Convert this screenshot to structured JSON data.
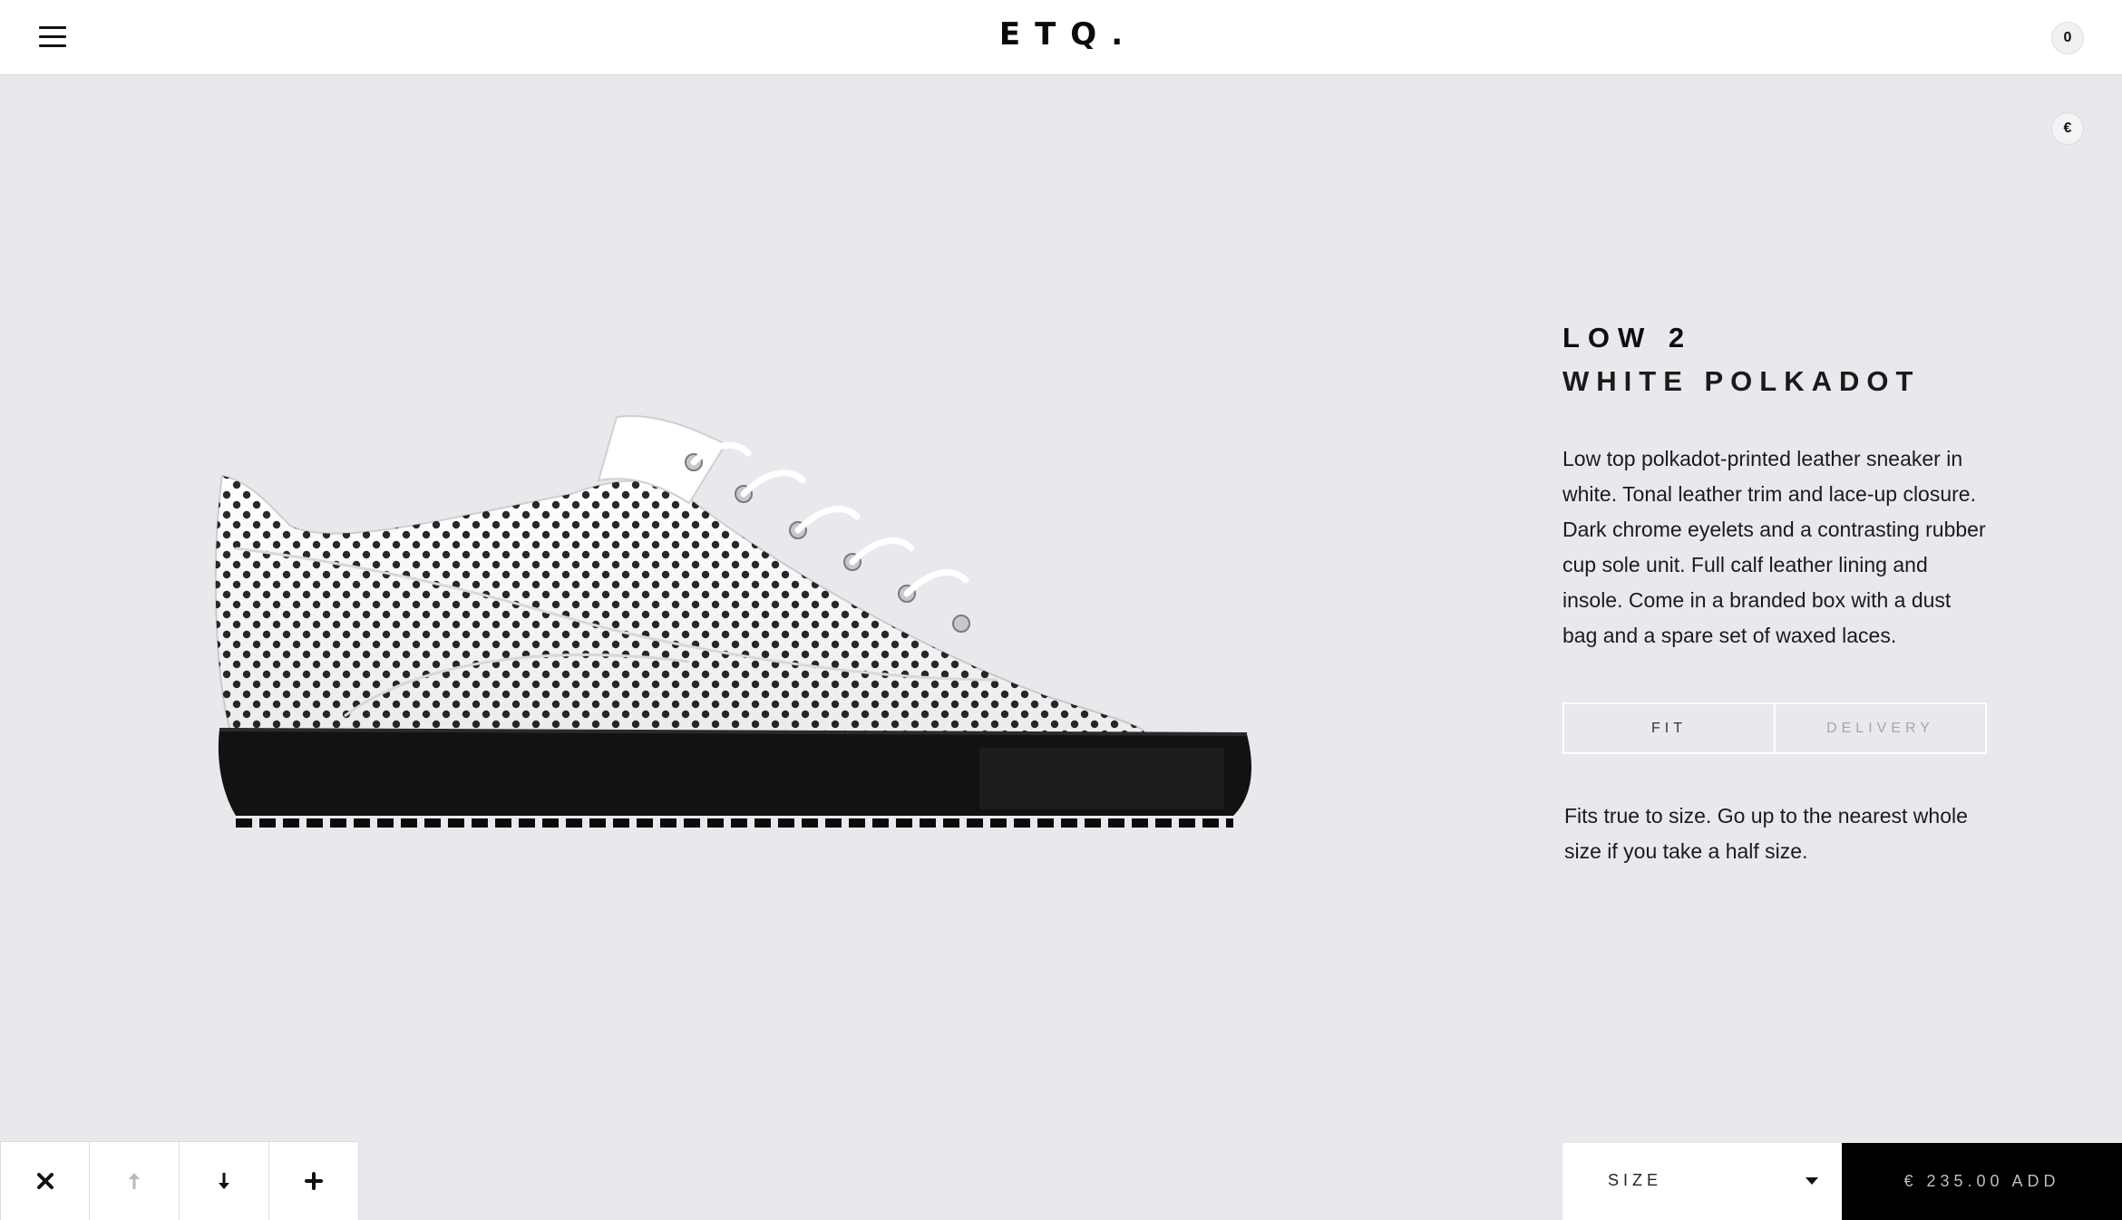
{
  "header": {
    "brand": "ETQ.",
    "cart_count": "0"
  },
  "currency": {
    "symbol": "€"
  },
  "product": {
    "name": "LOW 2",
    "variant": "WHITE POLKADOT",
    "description": "Low top polkadot-printed leather sneaker in white. Tonal leather trim and lace-up closure. Dark chrome eyelets and a contrasting rubber cup sole unit. Full calf leather lining and insole. Come in a branded box with a dust bag and a spare set of waxed laces.",
    "image_icon": "sneaker-image"
  },
  "tabs": [
    {
      "label": "FIT",
      "active": true
    },
    {
      "label": "DELIVERY",
      "active": false
    }
  ],
  "fit_text": "Fits true to size. Go up to the nearest whole size if you take a half size.",
  "bottom_nav": {
    "icons": [
      "close-icon",
      "arrow-up-icon",
      "arrow-down-icon",
      "plus-icon"
    ]
  },
  "purchase": {
    "size_label": "SIZE",
    "add_label": "€ 235.00 ADD"
  },
  "colors": {
    "background": "#e9e9ed",
    "header": "#ffffff",
    "add_button": "#000000",
    "disabled_icon": "#b9b9be"
  }
}
